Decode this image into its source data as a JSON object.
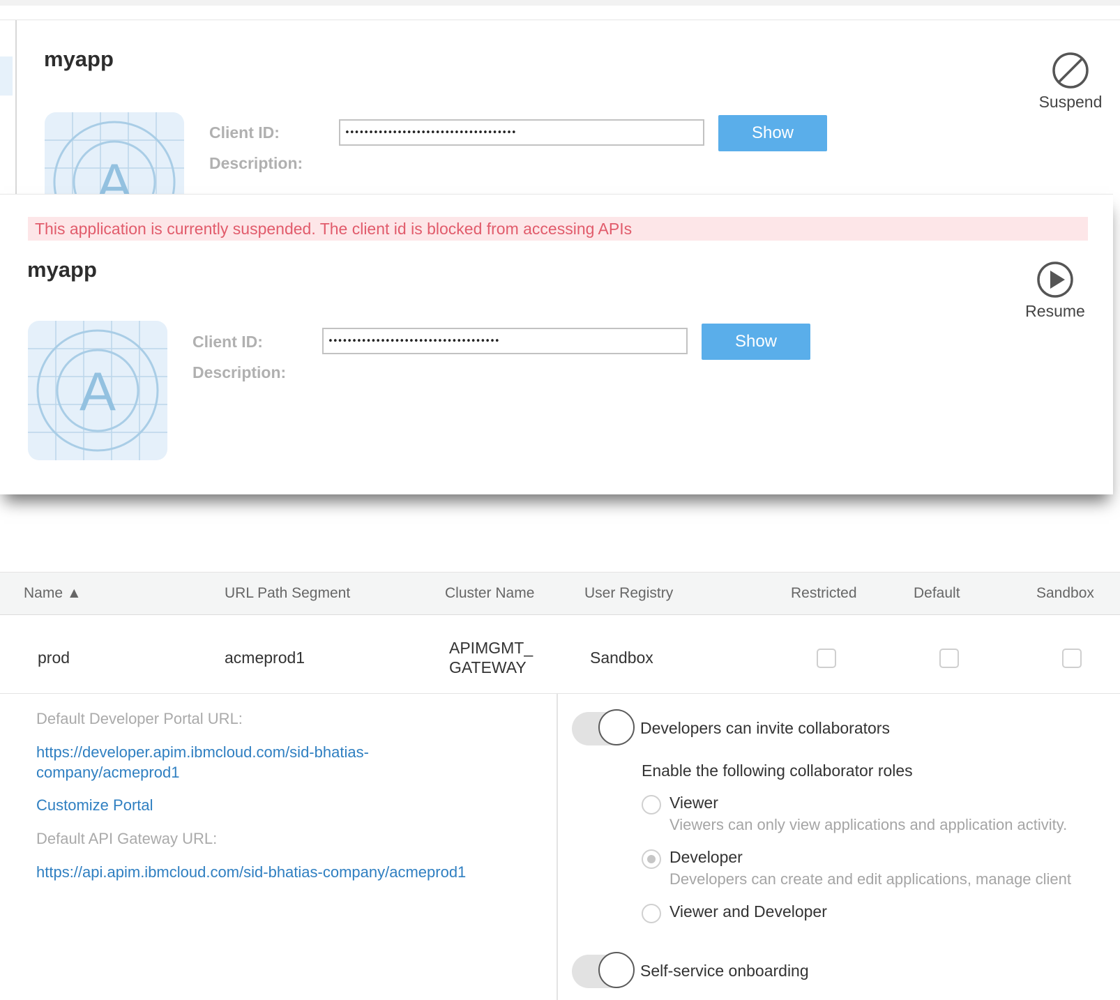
{
  "card1": {
    "title": "myapp",
    "client_id_label": "Client ID:",
    "client_id_value": "••••••••••••••••••••••••••••••••••••",
    "description_label": "Description:",
    "show_label": "Show",
    "action_label": "Suspend",
    "icon_letter": "A"
  },
  "card2": {
    "banner": "This application is currently suspended. The client id is blocked from accessing APIs",
    "title": "myapp",
    "client_id_label": "Client ID:",
    "client_id_value": "••••••••••••••••••••••••••••••••••••",
    "description_label": "Description:",
    "show_label": "Show",
    "action_label": "Resume",
    "icon_letter": "A"
  },
  "table": {
    "headers": [
      "Name ▲",
      "URL Path Segment",
      "Cluster Name",
      "User Registry",
      "Restricted",
      "Default",
      "Sandbox"
    ],
    "rows": [
      {
        "name": "prod",
        "url_path_segment": "acmeprod1",
        "cluster_name_line1": "APIMGMT_",
        "cluster_name_line2": "GATEWAY",
        "user_registry": "Sandbox",
        "restricted": false,
        "default": false,
        "sandbox": false
      }
    ]
  },
  "details": {
    "portal_url_label": "Default Developer Portal URL:",
    "portal_url": "https://developer.apim.ibmcloud.com/sid-bhatias-company/acmeprod1",
    "customize_portal": "Customize Portal",
    "gateway_url_label": "Default API Gateway URL:",
    "gateway_url": "https://api.apim.ibmcloud.com/sid-bhatias-company/acmeprod1"
  },
  "collaborators": {
    "invite_toggle_label": "Developers can invite collaborators",
    "roles_heading": "Enable the following collaborator roles",
    "roles": [
      {
        "label": "Viewer",
        "description": "Viewers can only view applications and application activity.",
        "selected": false
      },
      {
        "label": "Developer",
        "description": "Developers can create and edit applications, manage client",
        "selected": true
      },
      {
        "label": "Viewer and Developer",
        "description": "",
        "selected": false
      }
    ],
    "onboarding_toggle_label": "Self-service onboarding"
  },
  "colors": {
    "accent": "#5aaeea",
    "link": "#2f7fc1",
    "banner_bg": "#fde6e8",
    "banner_text": "#e15b6b"
  }
}
